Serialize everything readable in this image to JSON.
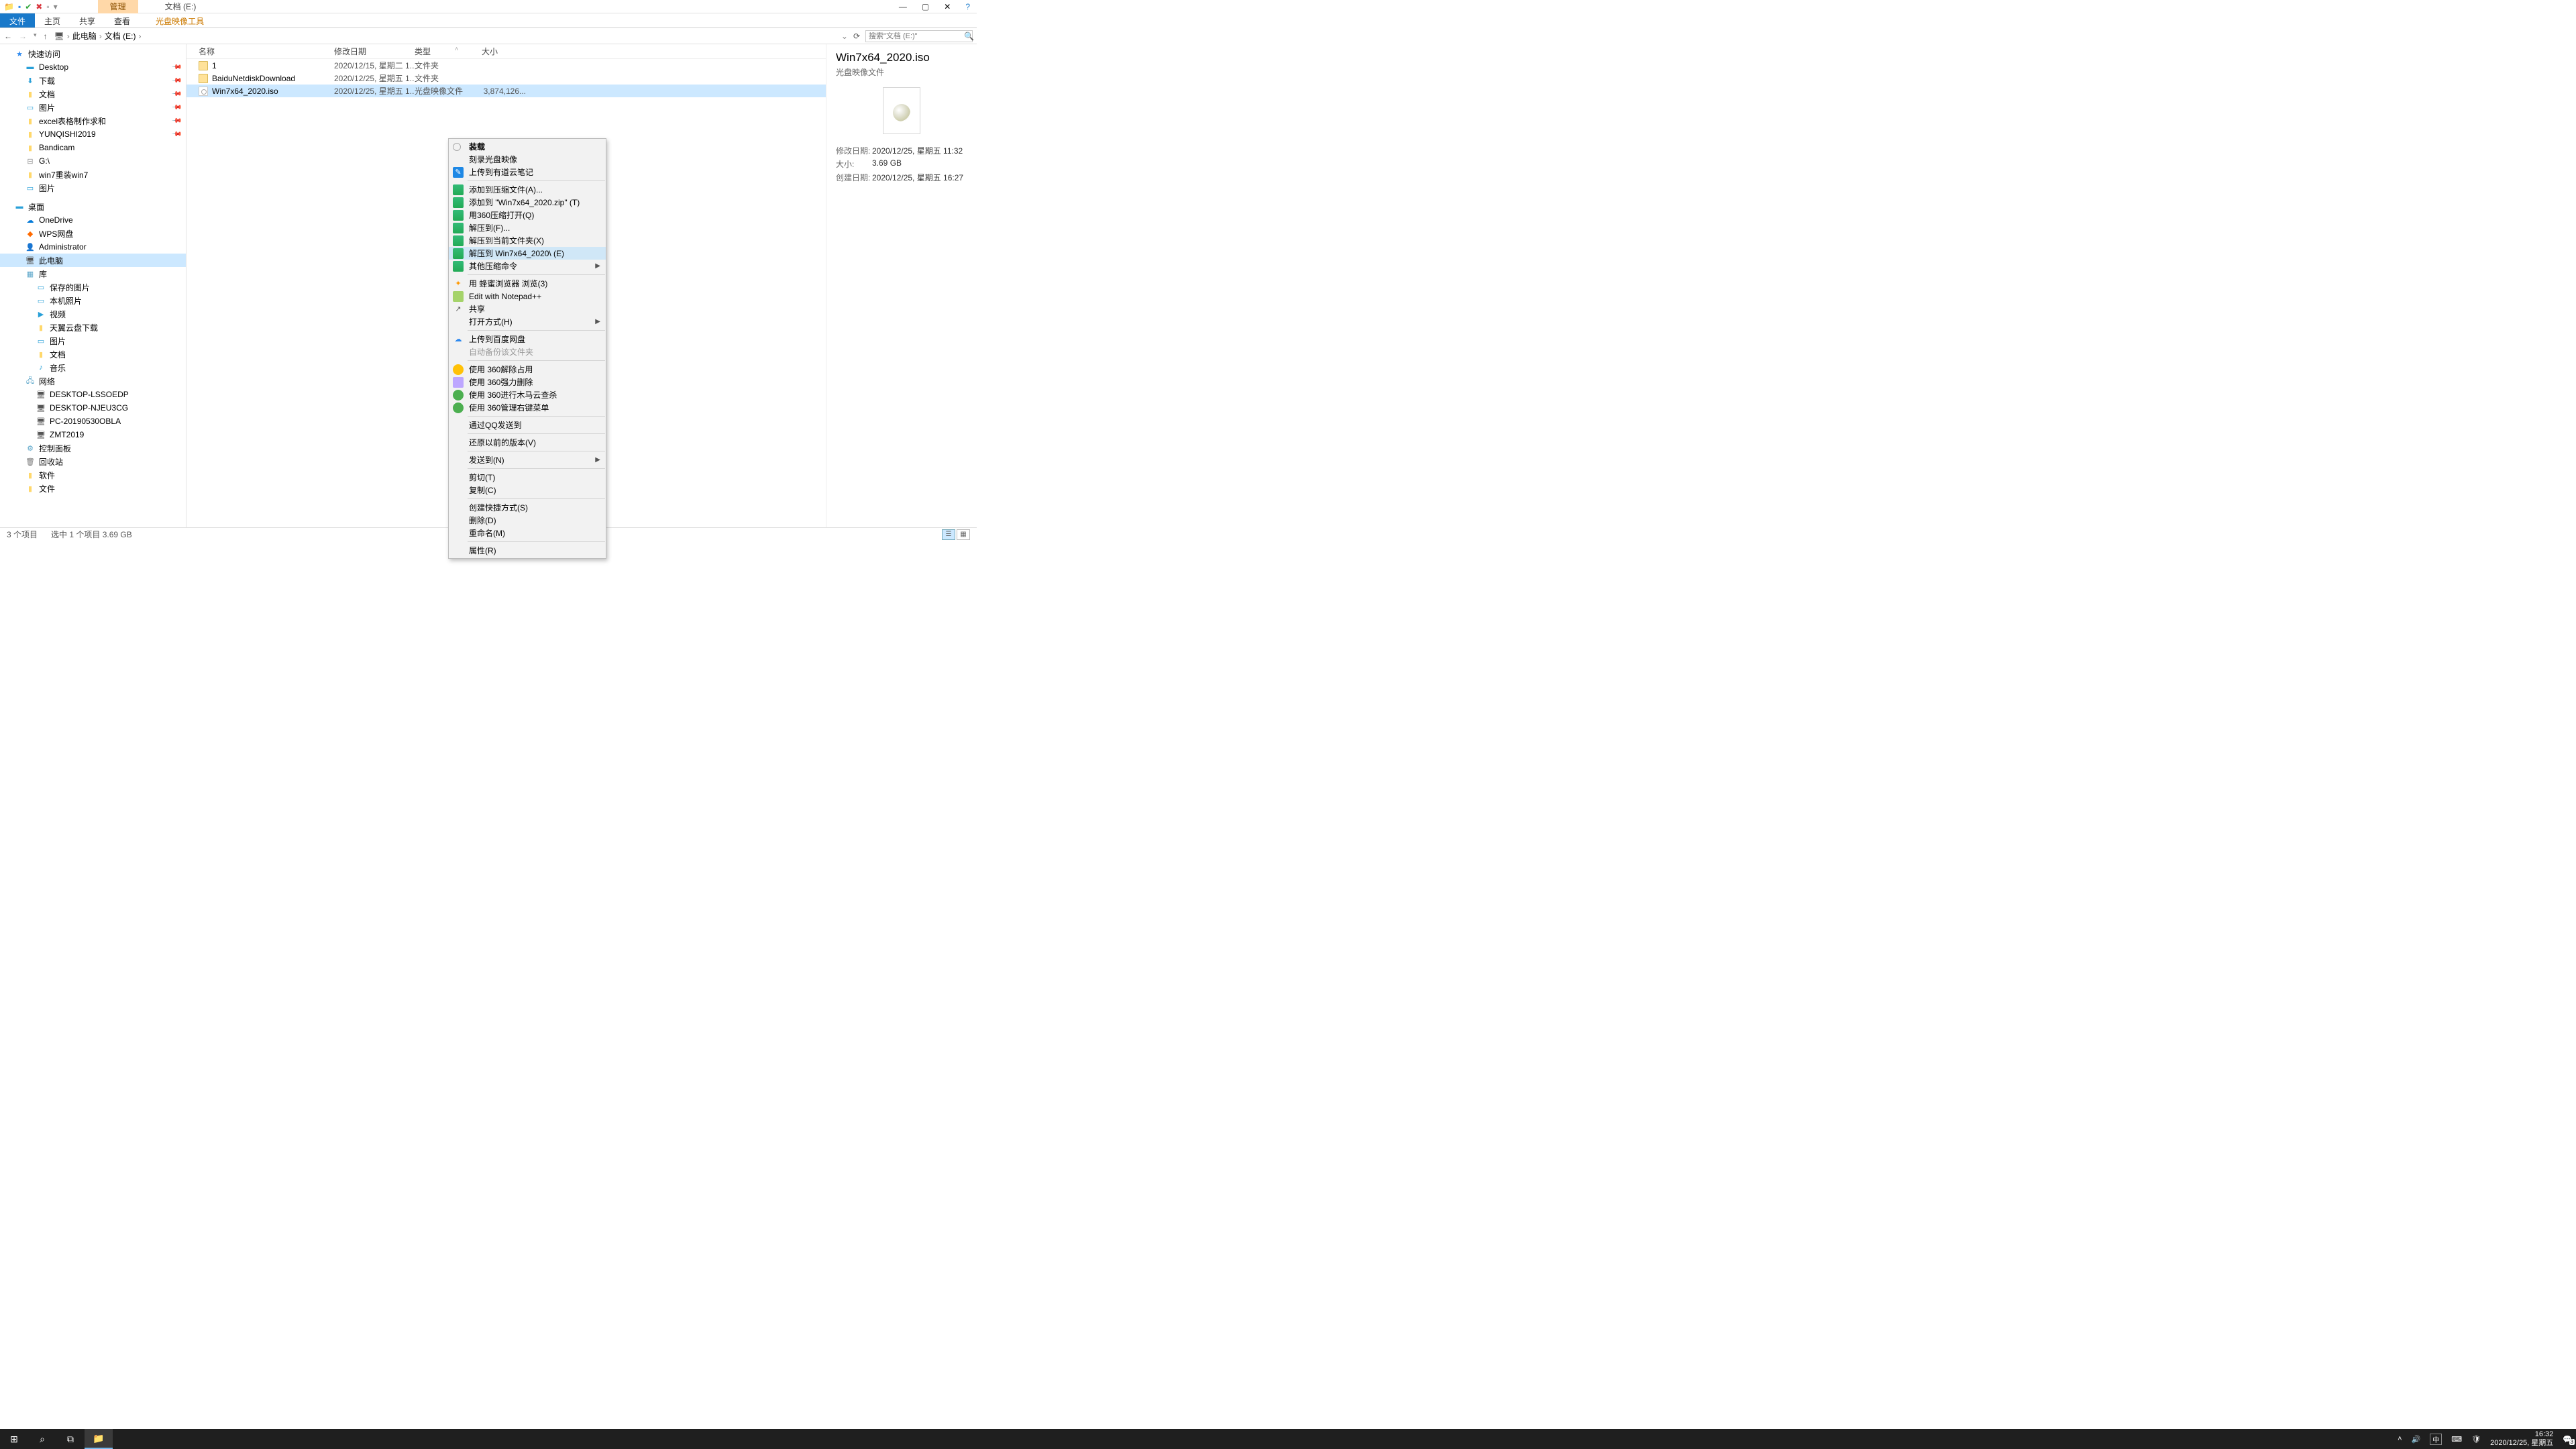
{
  "titlebar": {
    "contextual_label": "管理",
    "window_title": "文档 (E:)"
  },
  "ribbon": {
    "file": "文件",
    "home": "主页",
    "share": "共享",
    "view": "查看",
    "disc_tools": "光盘映像工具"
  },
  "breadcrumb": {
    "root": "此电脑",
    "loc": "文档 (E:)",
    "search_placeholder": "搜索\"文档 (E:)\""
  },
  "sidebar": {
    "quick_access": "快速访问",
    "desktop": "Desktop",
    "downloads": "下载",
    "documents": "文档",
    "pictures": "图片",
    "excel": "excel表格制作求和",
    "yunqishi": "YUNQISHI2019",
    "bandicam": "Bandicam",
    "g_drive": "G:\\",
    "win7repair": "win7重装win7",
    "pictures2": "图片",
    "desk_cn": "桌面",
    "onedrive": "OneDrive",
    "wps": "WPS网盘",
    "admin": "Administrator",
    "this_pc": "此电脑",
    "libraries": "库",
    "saved_pics": "保存的图片",
    "local_pics": "本机照片",
    "videos": "视频",
    "tianyi": "天翼云盘下载",
    "pics_lib": "图片",
    "docs_lib": "文档",
    "music_lib": "音乐",
    "network": "网络",
    "pc1": "DESKTOP-LSSOEDP",
    "pc2": "DESKTOP-NJEU3CG",
    "pc3": "PC-20190530OBLA",
    "pc4": "ZMT2019",
    "control_panel": "控制面板",
    "recycle": "回收站",
    "software": "软件",
    "files": "文件"
  },
  "columns": {
    "name": "名称",
    "date": "修改日期",
    "type": "类型",
    "size": "大小"
  },
  "rows": [
    {
      "name": "1",
      "date": "2020/12/15, 星期二 1...",
      "type": "文件夹",
      "size": ""
    },
    {
      "name": "BaiduNetdiskDownload",
      "date": "2020/12/25, 星期五 1...",
      "type": "文件夹",
      "size": ""
    },
    {
      "name": "Win7x64_2020.iso",
      "date": "2020/12/25, 星期五 1...",
      "type": "光盘映像文件",
      "size": "3,874,126..."
    }
  ],
  "context_menu": {
    "mount": "装载",
    "burn": "刻录光盘映像",
    "youdao": "上传到有道云笔记",
    "add_archive": "添加到压缩文件(A)...",
    "add_zip": "添加到 \"Win7x64_2020.zip\" (T)",
    "open_360zip": "用360压缩打开(Q)",
    "extract_to": "解压到(F)...",
    "extract_here": "解压到当前文件夹(X)",
    "extract_named": "解压到 Win7x64_2020\\ (E)",
    "other_zip": "其他压缩命令",
    "bee_browse": "用 蜂蜜浏览器 浏览(3)",
    "notepadpp": "Edit with Notepad++",
    "share": "共享",
    "open_with": "打开方式(H)",
    "baidu_upload": "上传到百度网盘",
    "auto_backup": "自动备份该文件夹",
    "unlock_360": "使用 360解除占用",
    "force_del_360": "使用 360强力删除",
    "trojan_360": "使用 360进行木马云查杀",
    "manage_360": "使用 360管理右键菜单",
    "qq_send": "通过QQ发送到",
    "restore_prev": "还原以前的版本(V)",
    "send_to": "发送到(N)",
    "cut": "剪切(T)",
    "copy": "复制(C)",
    "shortcut": "创建快捷方式(S)",
    "delete": "删除(D)",
    "rename": "重命名(M)",
    "properties": "属性(R)"
  },
  "details": {
    "title": "Win7x64_2020.iso",
    "subtitle": "光盘映像文件",
    "mod_label": "修改日期:",
    "mod_val": "2020/12/25, 星期五 11:32",
    "size_label": "大小:",
    "size_val": "3.69 GB",
    "create_label": "创建日期:",
    "create_val": "2020/12/25, 星期五 16:27"
  },
  "status": {
    "count": "3 个项目",
    "selection": "选中 1 个项目  3.69 GB"
  },
  "taskbar": {
    "time": "16:32",
    "date": "2020/12/25, 星期五",
    "ime": "中",
    "notif": "3"
  }
}
